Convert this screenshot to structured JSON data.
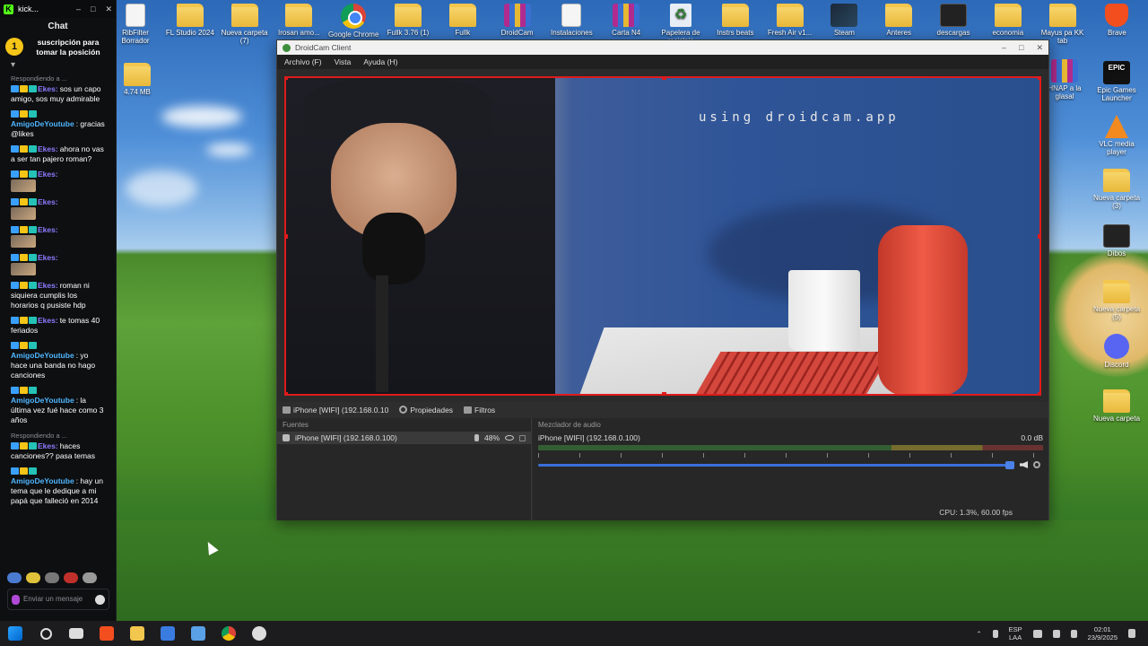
{
  "chat": {
    "window_title": "kick...",
    "panel_title": "Chat",
    "pinned": {
      "badge": "1",
      "text": "suscripción para tomar la posición"
    },
    "messages": [
      {
        "reply": "Respondiendo a ...",
        "user": "Ekes:",
        "user_style": "likes",
        "text": "sos un capo amigo, sos muy admirable"
      },
      {
        "reply": "",
        "user": "AmigoDeYoutube",
        "user_style": "amigo",
        "text": ": gracias @likes"
      },
      {
        "reply": "",
        "user": "Ekes:",
        "user_style": "likes",
        "text": "ahora no vas a ser tan pajero roman?"
      },
      {
        "reply": "",
        "user": "Ekes:",
        "user_style": "likes",
        "text": "",
        "emote": true
      },
      {
        "reply": "",
        "user": "Ekes:",
        "user_style": "likes",
        "text": "",
        "emote": true
      },
      {
        "reply": "",
        "user": "Ekes:",
        "user_style": "likes",
        "text": "",
        "emote": true
      },
      {
        "reply": "",
        "user": "Ekes:",
        "user_style": "likes",
        "text": "",
        "emote": true
      },
      {
        "reply": "",
        "user": "Ekes:",
        "user_style": "likes",
        "text": "roman ni siquiera cumplis los horarios q pusiste hdp"
      },
      {
        "reply": "",
        "user": "Ekes:",
        "user_style": "likes",
        "text": "te tomas 40 feriados"
      },
      {
        "reply": "",
        "user": "AmigoDeYoutube",
        "user_style": "amigo",
        "text": ": yo hace una banda no hago canciones"
      },
      {
        "reply": "",
        "user": "AmigoDeYoutube",
        "user_style": "amigo",
        "text": ": la última vez fué hace como 3 años"
      },
      {
        "reply": "Respondiendo a ...",
        "user": "Ekes:",
        "user_style": "likes",
        "text": "haces canciones?? pasa temas"
      },
      {
        "reply": "",
        "user": "AmigoDeYoutube",
        "user_style": "amigo",
        "text": ": hay un tema que le dedique a mi papá que falleció en 2014"
      }
    ],
    "composer_placeholder": "Enviar un mensaje"
  },
  "desktop_icons_top": [
    {
      "label": "RibFilter Borrador",
      "kind": "doc"
    },
    {
      "label": "FL Studio 2024",
      "kind": "folder"
    },
    {
      "label": "Nueva carpeta (7)",
      "kind": "folder"
    },
    {
      "label": "Irosan amo...",
      "kind": "folder"
    },
    {
      "label": "Google Chrome",
      "kind": "chrome"
    },
    {
      "label": "Fullk 3.76 (1)",
      "kind": "folder"
    },
    {
      "label": "Fullk",
      "kind": "folder"
    },
    {
      "label": "DroidCam",
      "kind": "rar"
    },
    {
      "label": "Instalaciones",
      "kind": "doc"
    },
    {
      "label": "Carta N4",
      "kind": "rar"
    },
    {
      "label": "Papelera de reciclaje",
      "kind": "recycle"
    },
    {
      "label": "Instrs beats",
      "kind": "folder"
    },
    {
      "label": "Fresh Air v1...",
      "kind": "folder"
    },
    {
      "label": "Steam",
      "kind": "steam"
    },
    {
      "label": "Anteres",
      "kind": "folder"
    },
    {
      "label": "descargas",
      "kind": "dark"
    },
    {
      "label": "economia",
      "kind": "folder"
    },
    {
      "label": "Mayus pa KK tab",
      "kind": "folder"
    },
    {
      "label": "Brave",
      "kind": "brave"
    }
  ],
  "desktop_icons_right": [
    {
      "label": "HNAP a la glasal",
      "kind": "rar"
    },
    {
      "label": "Epic Games Launcher",
      "kind": "epic",
      "glyph": "EPIC"
    },
    {
      "label": "VLC media player",
      "kind": "vlc"
    },
    {
      "label": "Nueva carpeta (3)",
      "kind": "folder"
    },
    {
      "label": "Dibos",
      "kind": "dark"
    },
    {
      "label": "Nueva carpeta (5)",
      "kind": "folder"
    },
    {
      "label": "Discord",
      "kind": "discord"
    },
    {
      "label": "Nueva carpeta",
      "kind": "folder"
    }
  ],
  "desktop_extra_icon": {
    "label": "4.74 MB",
    "kind": "folder"
  },
  "droidcam": {
    "title": "DroidCam Client",
    "menu": [
      "Archivo (F)",
      "Vista",
      "Ayuda (H)"
    ],
    "watermark": "using droidcam.app",
    "source_bar": {
      "source": "iPhone [WIFI] (192.168.0.10",
      "properties": "Propiedades",
      "filters": "Filtros"
    },
    "sources_dock": {
      "title": "Fuentes",
      "item": "iPhone [WIFI] (192.168.0.100)",
      "volume": "48%"
    },
    "mixer_dock": {
      "title": "Mezclador de audio",
      "channel": "iPhone [WIFI] (192.168.0.100)",
      "db": "0.0 dB"
    },
    "status": "CPU: 1.3%, 60.00 fps"
  },
  "taskbar": {
    "language": "ESP\nLAA",
    "time": "02:01",
    "date": "23/9/2025"
  }
}
